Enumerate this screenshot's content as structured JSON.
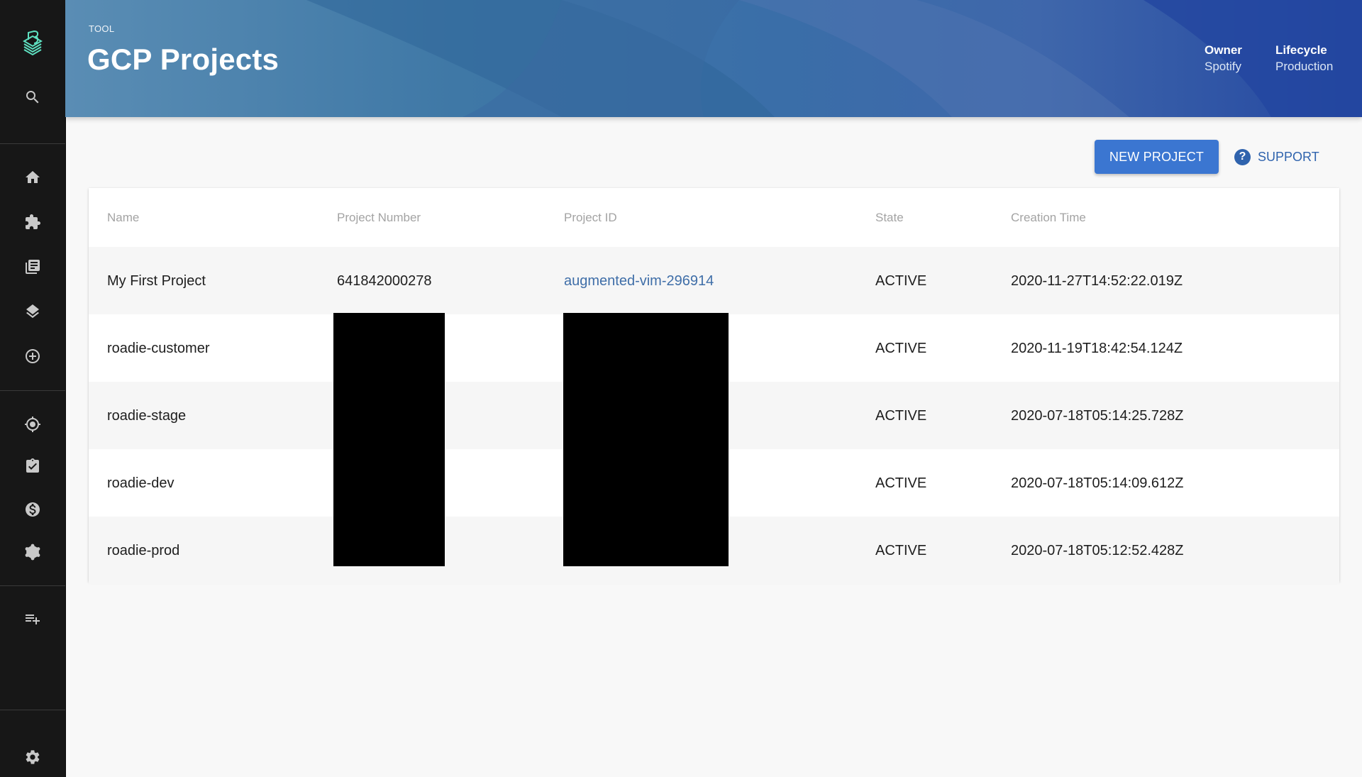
{
  "sidebar": {
    "logo": "backstage-logo-icon",
    "top_items": [
      {
        "icon": "search-icon",
        "label": "Search"
      }
    ],
    "main_items": [
      {
        "icon": "home-icon",
        "label": "Home"
      },
      {
        "icon": "puzzle-icon",
        "label": "APIs"
      },
      {
        "icon": "docs-icon",
        "label": "Docs"
      },
      {
        "icon": "layers-icon",
        "label": "Tech Radar"
      },
      {
        "icon": "add-circle-icon",
        "label": "Create"
      }
    ],
    "plugin_items": [
      {
        "icon": "target-icon",
        "label": "Lighthouse"
      },
      {
        "icon": "clipboard-check-icon",
        "label": "Tasks"
      },
      {
        "icon": "dollar-icon",
        "label": "Cost Insights"
      },
      {
        "icon": "graphql-icon",
        "label": "GraphiQL"
      }
    ],
    "shortcut_items": [
      {
        "icon": "playlist-add-icon",
        "label": "Add shortcut"
      }
    ],
    "bottom_items": [
      {
        "icon": "gear-icon",
        "label": "Settings"
      }
    ]
  },
  "header": {
    "type": "TOOL",
    "title": "GCP Projects",
    "meta": [
      {
        "label": "Owner",
        "value": "Spotify"
      },
      {
        "label": "Lifecycle",
        "value": "Production"
      }
    ]
  },
  "actions": {
    "new_project": "NEW PROJECT",
    "support": "SUPPORT",
    "support_icon": "?"
  },
  "table": {
    "columns": [
      "Name",
      "Project Number",
      "Project ID",
      "State",
      "Creation Time"
    ],
    "rows": [
      {
        "name": "My First Project",
        "number": "641842000278",
        "id": "augmented-vim-296914",
        "state": "ACTIVE",
        "created": "2020-11-27T14:52:22.019Z"
      },
      {
        "name": "roadie-customer",
        "number": "",
        "id": "",
        "state": "ACTIVE",
        "created": "2020-11-19T18:42:54.124Z"
      },
      {
        "name": "roadie-stage",
        "number": "",
        "id": "",
        "state": "ACTIVE",
        "created": "2020-07-18T05:14:25.728Z"
      },
      {
        "name": "roadie-dev",
        "number": "",
        "id": "",
        "state": "ACTIVE",
        "created": "2020-07-18T05:14:09.612Z"
      },
      {
        "name": "roadie-prod",
        "number": "",
        "id": "",
        "state": "ACTIVE",
        "created": "2020-07-18T05:12:52.428Z"
      }
    ],
    "redacted_columns": [
      "Project Number",
      "Project ID"
    ]
  },
  "colors": {
    "accent": "#3b76d1",
    "link": "#3f6ea8",
    "sidebar_bg": "#171717",
    "logo": "#5ee0c0"
  }
}
